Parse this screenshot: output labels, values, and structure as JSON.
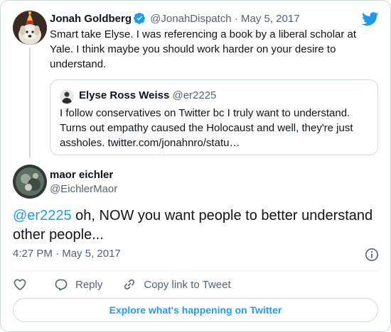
{
  "parent_tweet": {
    "name": "Jonah Goldberg",
    "handle": "@JonahDispatch",
    "separator": "·",
    "date": "May 5, 2017",
    "text": "Smart take Elyse. I was referencing a book by a liberal scholar at Yale. I think maybe you should work harder on your desire to understand.",
    "avatar_icon": "dog-party-hat-avatar",
    "verified_icon": "verified-badge-icon"
  },
  "quoted_tweet": {
    "name": "Elyse Ross Weiss",
    "handle": "@er2225",
    "text": "I follow conservatives on Twitter bc I truly want to understand. Turns out empathy caused the Holocaust and well, they're just assholes. twitter.com/jonahnro/statu…",
    "avatar_icon": "person-avatar"
  },
  "main_tweet": {
    "name": "maor eichler",
    "handle": "@EichlerMaor",
    "mention": "@er2225",
    "text": " oh, NOW you want people to better understand other people...",
    "time": "4:27 PM",
    "separator": "·",
    "date": "May 5, 2017",
    "avatar_icon": "photo-avatar"
  },
  "actions": {
    "reply_label": "Reply",
    "copy_link_label": "Copy link to Tweet"
  },
  "explore_label": "Explore what's happening on Twitter",
  "colors": {
    "accent": "#1d9bf0",
    "text": "#0f1419",
    "secondary": "#536471",
    "border": "#cfd9de"
  }
}
